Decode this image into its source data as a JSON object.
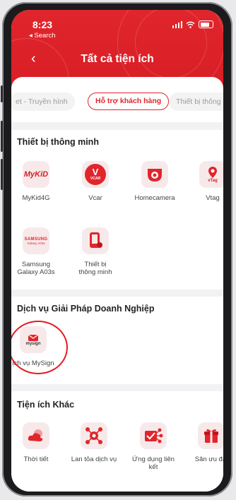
{
  "status": {
    "time": "8:23",
    "back_app": "◂ Search"
  },
  "header": {
    "title": "Tất cả tiện ích"
  },
  "tabs": [
    {
      "label": "et - Truyền hình",
      "active": false
    },
    {
      "label": "Hỗ trợ khách hàng",
      "active": true
    },
    {
      "label": "Thiết bị thông m",
      "active": false
    }
  ],
  "sections": {
    "smart_devices": {
      "title": "Thiết bị thông minh",
      "items": [
        {
          "label": "MyKid4G",
          "icon_text": "MyKiD"
        },
        {
          "label": "Vcar",
          "icon_text": "VCAR"
        },
        {
          "label": "Homecamera",
          "icon_text": ""
        },
        {
          "label": "Vtag",
          "icon_text": "vTag"
        },
        {
          "label": "Samsung Galaxy A03s",
          "line1": "Samsung",
          "line2": "Galaxy A03s",
          "icon_text": "SAMSUNG",
          "icon_sub": "Galaxy A03s"
        },
        {
          "label": "Thiết bị thông minh",
          "line1": "Thiết bị",
          "line2": "thông minh",
          "icon_text": ""
        }
      ]
    },
    "business": {
      "title": "Dịch vụ Giải Pháp Doanh Nghiệp",
      "items": [
        {
          "label": "ịch vụ MySign",
          "icon_text": "mysign"
        }
      ]
    },
    "other": {
      "title": "Tiện ích Khác",
      "items": [
        {
          "label": "Thời tiết"
        },
        {
          "label": "Lan tỏa dịch vụ"
        },
        {
          "label": "Ứng dụng liên kết"
        },
        {
          "label": "Săn ưu đãi"
        }
      ]
    }
  },
  "colors": {
    "brand_red": "#e0262c",
    "icon_bg": "#f7e9ea",
    "annotation_red": "#e31b23"
  }
}
